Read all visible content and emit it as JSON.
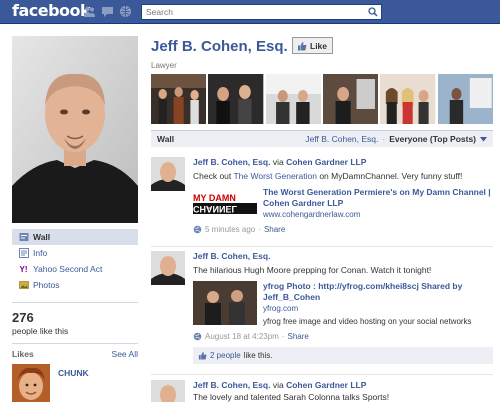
{
  "topbar": {
    "logo": "facebook",
    "search_placeholder": "Search",
    "jewels": [
      "friend-requests-icon",
      "messages-icon",
      "notifications-icon"
    ]
  },
  "profile": {
    "name": "Jeff B. Cohen, Esq.",
    "subtitle": "Lawyer",
    "like_button_label": "Like"
  },
  "left_nav": {
    "items": [
      {
        "label": "Wall",
        "icon": "wall-icon",
        "active": true
      },
      {
        "label": "Info",
        "icon": "info-icon",
        "active": false
      },
      {
        "label": "Yahoo Second Act",
        "icon": "yahoo-icon",
        "active": false
      },
      {
        "label": "Photos",
        "icon": "photos-icon",
        "active": false
      }
    ]
  },
  "likes_box": {
    "count": "276",
    "text": "people like this"
  },
  "likes_section": {
    "title": "Likes",
    "see_all": "See All",
    "pages": [
      {
        "name": "CHUNK"
      }
    ]
  },
  "wall": {
    "title": "Wall",
    "filter_name": "Jeff B. Cohen, Esq.",
    "filter_sep": "·",
    "filter_value": "Everyone (Top Posts)",
    "stories": [
      {
        "author": "Jeff B. Cohen, Esq.",
        "via": "via",
        "source": "Cohen Gardner LLP",
        "message_pre": "Check out ",
        "message_link": "The Worst Generation",
        "message_post": " on MyDamnChannel. Very funny stuff!",
        "attach_title": "The Worst Generation Permiere's on My Damn Channel | Cohen Gardner LLP",
        "attach_domain": "www.cohengardnerlaw.com",
        "attach_desc": "",
        "attach_thumb_text_1": "MY DAMN",
        "attach_thumb_text_2": "CHANNEL",
        "time": "5 minutes ago",
        "sep": "·",
        "share": "Share"
      },
      {
        "author": "Jeff B. Cohen, Esq.",
        "message": "The hilarious Hugh Moore prepping for Conan. Watch it tonight!",
        "attach_title": "yfrog Photo : http://yfrog.com/khei8scj Shared by Jeff_B_Cohen",
        "attach_domain": "yfrog.com",
        "attach_desc": "yfrog free image and video hosting on your social networks",
        "time": "August 18 at 4:23pm",
        "sep": "·",
        "share": "Share",
        "likes_count": "2 people",
        "likes_suffix": "like this."
      },
      {
        "author": "Jeff B. Cohen, Esq.",
        "via": "via",
        "source": "Cohen Gardner LLP",
        "message": "The lovely and talented Sarah Colonna talks Sports!"
      }
    ]
  },
  "colors": {
    "brand_blue": "#3b5998",
    "wall_header_bg": "#edeff4",
    "active_nav_bg": "#d8dfea"
  }
}
